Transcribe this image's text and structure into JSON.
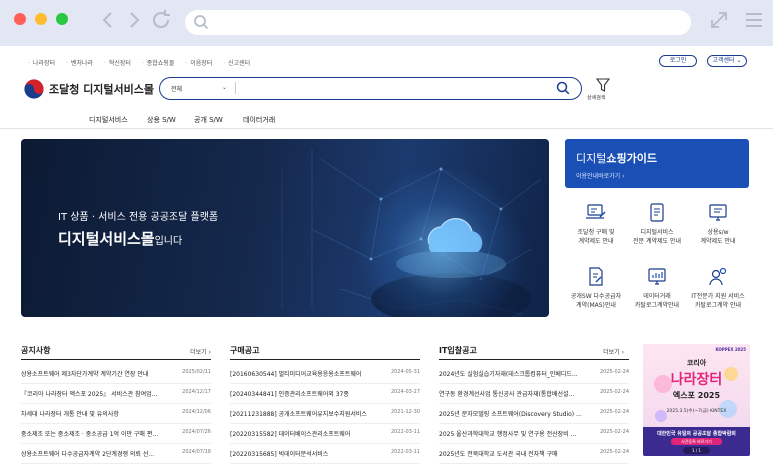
{
  "util_links": [
    "나라장터",
    "벤처나라",
    "혁신장터",
    "종합쇼핑몰",
    "이음장터",
    "신고센터"
  ],
  "util_buttons": {
    "login": "로그인",
    "customer": "고객센터"
  },
  "header": {
    "logo_text": "조달청 디지털서비스몰",
    "search_category": "전체",
    "search_placeholder": "",
    "advanced_search": "상세검색"
  },
  "main_nav": [
    "디지털서비스",
    "상용 S/W",
    "공개 S/W",
    "데이터거래"
  ],
  "hero": {
    "subtitle": "IT 상품 · 서비스 전용 공공조달 플랫폼",
    "title_main": "디지털서비스몰",
    "title_suffix": "입니다"
  },
  "guide": {
    "title_light": "디지털",
    "title_bold": "쇼핑가이드",
    "link": "이용안내바로가기"
  },
  "quick_links": [
    {
      "label": "조달청 구매 및\n계약제도 안내",
      "icon": "laptop-edit-icon"
    },
    {
      "label": "디지털서비스\n전문 계약제도 안내",
      "icon": "tablet-doc-icon"
    },
    {
      "label": "상용s/w\n계약제도 안내",
      "icon": "monitor-doc-icon"
    },
    {
      "label": "공개SW 다수공급자\n계약(MAS)안내",
      "icon": "doc-edit-icon"
    },
    {
      "label": "데이터거래\n카탈로그계약안내",
      "icon": "monitor-chart-icon"
    },
    {
      "label": "IT전문가 지원 서비스\n카탈로그계약 안내",
      "icon": "person-gear-icon"
    }
  ],
  "boards": {
    "notice": {
      "title": "공지사항",
      "more": "더보기",
      "rows": [
        {
          "text": "상용소프트웨어 제3자단가계약 계약기간 연장 안내",
          "date": "2025/02/11"
        },
        {
          "text": "『코리아 나라장터 엑스포 2025』 서비스관 참여업...",
          "date": "2024/12/17"
        },
        {
          "text": "차세대 나라장터 개통 안내 및 유의사항",
          "date": "2024/12/06"
        },
        {
          "text": "중소제조 또는 중소제조 · 중소공급 1억 이만 구매 편...",
          "date": "2024/07/26"
        },
        {
          "text": "상용소프트웨어 다수공급자계약 2단계경쟁 의뢰 선...",
          "date": "2024/07/18"
        }
      ]
    },
    "purchase": {
      "title": "구매공고",
      "rows": [
        {
          "text": "[20160630544] 멀티미디어교육용응용소프트웨어",
          "date": "2024-05-31"
        },
        {
          "text": "[20240344841] 인증관리소프트웨어외 37종",
          "date": "2024-03-27"
        },
        {
          "text": "[20211231888] 공개소프트웨어유지보수지원서비스",
          "date": "2021-12-30"
        },
        {
          "text": "[20220315582] 데이터베이스관리소프트웨어",
          "date": "2022-03-11"
        },
        {
          "text": "[20220315685] 빅데이터분석서비스",
          "date": "2022-03-11"
        }
      ]
    },
    "bid": {
      "title": "IT입찰공고",
      "more": "더보기",
      "rows": [
        {
          "text": "2024년도 실험실습기자재(데스크톱컴퓨터_인베디드...",
          "date": "2025-02-24"
        },
        {
          "text": "연구동 환경계선사업 통신공사 관급자재(통합배선설...",
          "date": "2025-02-24"
        },
        {
          "text": "2025년 문자모델링 소프트웨어(Discovery Studio) ...",
          "date": "2025-02-24"
        },
        {
          "text": "2025 울산과학대학교 행정사무 및 연구용 전산장비 ...",
          "date": "2025-02-24"
        },
        {
          "text": "2025년도 전북대학교 도서관 국내 전자책 구매",
          "date": "2025-02-24"
        }
      ]
    }
  },
  "promo": {
    "badge": "KOPPEX 2025",
    "headline_1": "코리아",
    "headline_2": "나라장터",
    "headline_3": "엑스포 2025",
    "dates": "2025.3.5(수)~7(금) KINTEX",
    "footer_1": "대한민국 유일의 공공조달 종합박람회",
    "footer_2": "사전등록 바로가기",
    "pager": "1 / 1"
  },
  "colors": {
    "brand": "#1a4fb5",
    "navy": "#1a3c8c"
  }
}
